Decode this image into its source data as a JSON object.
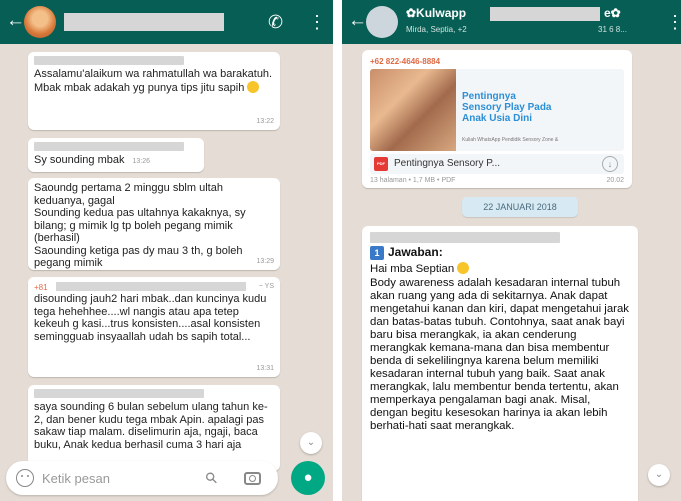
{
  "left_chat": {
    "messages": [
      {
        "text": "Assalamu'alaikum wa rahmatullah wa barakatuh.\nMbak mbak adakah yg punya tips jitu sapih",
        "time": "13:22"
      },
      {
        "text": "Sy sounding mbak",
        "time": "13:26"
      },
      {
        "text": "Saoundg pertama 2 minggu sblm ultah keduanya, gagal\nSounding kedua pas ultahnya kakaknya, sy bilang; g mimik lg tp boleh pegang mimik (berhasil)\nSaounding ketiga pas dy mau 3 th, g boleh pegang mimik",
        "time": "13:29"
      },
      {
        "phone": "+81",
        "sender_suffix": "~ YS",
        "text": "disounding jauh2 hari mbak..dan kuncinya kudu tega hehehhee....wl nangis atau apa tetep kekeuh g kasi...trus konsisten....asal konsisten semingguab insyaallah udah bs sapih total...",
        "time": "13:31"
      },
      {
        "text": "saya sounding 6 bulan sebelum ulang tahun ke-2, dan bener kudu tega mbak Apin. apalagi pas sakaw tiap malam. diselimurin aja, ngaji, baca buku, Anak kedua berhasil cuma 3 hari aja"
      }
    ],
    "input_placeholder": "Ketik pesan",
    "icons": {
      "back": "back-arrow-icon",
      "call": "add-call-icon",
      "menu": "more-vert-icon",
      "emoji": "emoji-icon",
      "attach": "paperclip-icon",
      "camera": "camera-icon",
      "mic": "mic-icon",
      "scroll": "scroll-down-icon"
    }
  },
  "right_chat": {
    "group_title": "✿Kulwapp",
    "title_suffix": "e✿",
    "group_subtitle": "Mirda, Septia, +2",
    "subtitle_suffix": "31 6 8...",
    "document_message": {
      "sender_phone": "+62 822-4646-8884",
      "preview_title": "Pentingnya\nSensory Play Pada\nAnak Usia Dini",
      "preview_subtitle": "Kuliah WhatsApp Pendidik Sensory Zone &",
      "filename": "Pentingnya Sensory P...",
      "meta": "13 halaman • 1,7 MB • PDF",
      "time": "20.02"
    },
    "date_chip": "22 JANUARI 2018",
    "answer": {
      "heading": "Jawaban:",
      "greeting": "Hai mba Septian",
      "body": "Body awareness adalah kesadaran internal tubuh akan ruang yang ada di sekitarnya. Anak dapat mengetahui kanan dan kiri, dapat mengetahui jarak dan batas-batas tubuh. Contohnya, saat anak bayi baru bisa merangkak, ia akan cenderung merangkak kemana-mana dan bisa membentur benda di sekelilingnya karena belum memiliki kesadaran internal tubuh yang baik. Saat anak merangkak, lalu membentur benda tertentu, akan memperkaya pengalaman bagi anak. Misal, dengan begitu kesesokan harinya ia akan lebih berhati-hati saat merangkak."
    }
  },
  "colors": {
    "header": "#075e54",
    "chat_bg": "#e5ddd5",
    "accent": "#00a884",
    "phone": "#e06b45",
    "link": "#2b8fd6"
  }
}
